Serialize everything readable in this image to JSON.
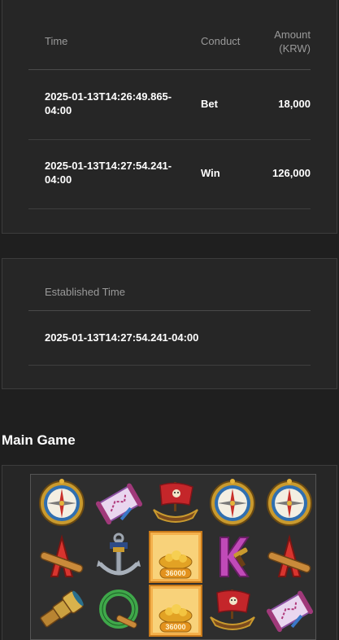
{
  "transactions": {
    "headers": {
      "time": "Time",
      "conduct": "Conduct",
      "amount_line1": "Amount",
      "amount_line2": "(KRW)"
    },
    "rows": [
      {
        "time_line1": "2025-01-13T14:26:49.865-",
        "time_line2": "04:00",
        "conduct": "Bet",
        "amount": "18,000"
      },
      {
        "time_line1": "2025-01-13T14:27:54.241-",
        "time_line2": "04:00",
        "conduct": "Win",
        "amount": "126,000"
      }
    ]
  },
  "established": {
    "header": "Established Time",
    "value": "2025-01-13T14:27:54.241-04:00"
  },
  "main_game": {
    "title": "Main Game",
    "grid": [
      [
        "compass-symbol",
        "scroll-map-symbol",
        "pirate-ship-symbol",
        "compass-symbol",
        "compass-symbol"
      ],
      [
        "letter-a-symbol",
        "anchor-symbol",
        "gold-treasure-symbol",
        "letter-k-symbol",
        "letter-a-symbol"
      ],
      [
        "spyglass-symbol",
        "letter-q-symbol",
        "gold-treasure-symbol",
        "pirate-ship-symbol",
        "scroll-map-symbol"
      ]
    ],
    "treasure_label": "36000"
  }
}
